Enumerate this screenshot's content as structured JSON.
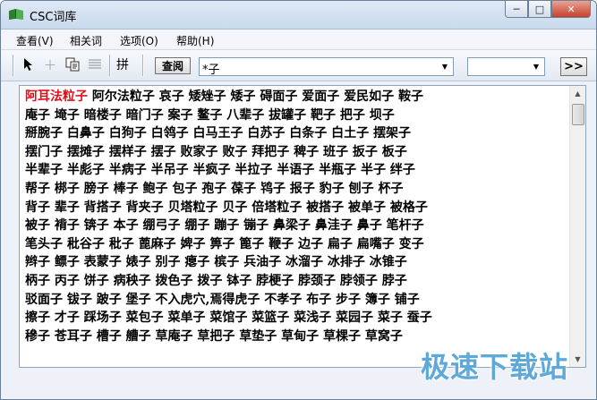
{
  "window": {
    "title": "CSC词库",
    "controls": {
      "minimize": "─",
      "maximize": "□",
      "close": "✕"
    }
  },
  "menu": [
    {
      "label": "查看(V)"
    },
    {
      "label": "相关词"
    },
    {
      "label": "选项(O)"
    },
    {
      "label": "帮助(H)"
    }
  ],
  "toolbar": {
    "tool_icons": [
      "pointer-icon",
      "add-icon",
      "copy-icon",
      "list-icon"
    ],
    "pin_label": "拼",
    "query_label": "查阅",
    "search_value": "*子",
    "filter_value": "",
    "go_label": ">>"
  },
  "words": {
    "highlight": "阿耳法粒子",
    "rows": [
      "阿尔法粒子  哀子  矮矬子  矮子  碍面子  爱面子  爱民如子  鞍子",
      "庵子  埯子  暗楼子  暗门子  案子  鳌子  八辈子  拔罐子  靶子  把子  坝子",
      "掰腕子  白鼻子  白狗子  白鸰子  白马王子  白苏子  白条子  白土子  摆架子",
      "摆门子  摆摊子  摆样子  摆子  败家子  败子  拜把子  稗子  班子  扳子  板子",
      "半辈子  半彪子  半病子  半吊子  半疯子  半拉子  半语子  半瓶子  半子  绊子",
      "帮子  梆子  膀子  棒子  鲍子  包子  孢子  葆子  鸨子  报子  豹子  刨子  杯子",
      "背子  辈子  背搭子  背夹子  贝塔粒子  贝子  倍塔粒子  被搭子  被单子  被格子",
      "被子  褙子  锛子  本子  绷弓子  绷子  蹦子  镚子  鼻梁子  鼻洼子  鼻子  笔杆子",
      "笔头子  秕谷子  秕子  蓖麻子  婢子  箅子  篦子  鞭子  边子  扁子  扁嘴子  变子",
      "辫子  鳔子  表蒙子  婊子  别子  瘪子  槟子  兵油子  冰溜子  冰排子  冰锥子",
      "柄子  丙子  饼子  病秧子  拨色子  拨子  钵子  脖梗子  脖颈子  脖领子  脖子",
      "驳面子  钹子  跛子  堡子  不入虎穴,焉得虎子  不孝子  布子  步子  簿子  铺子",
      "擦子  才子  踩场子  菜包子  菜单子  菜馆子  菜篮子  菜浅子  菜园子  菜子  蚕子",
      "穇子  苍耳子  槽子  艚子  草庵子  草把子  草垫子  草甸子  草棵子  草窝子"
    ]
  },
  "watermark": "极速下载站"
}
